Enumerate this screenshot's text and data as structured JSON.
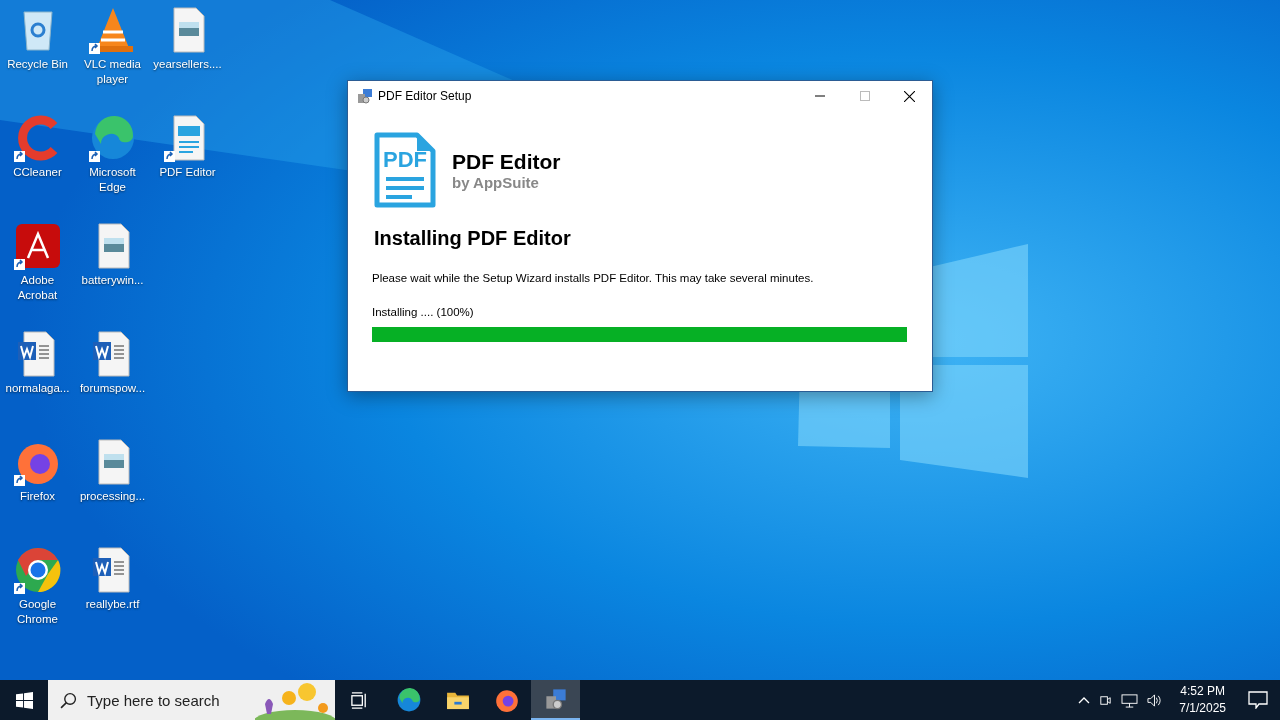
{
  "desktop": {
    "icons": [
      {
        "label": "Recycle Bin",
        "kind": "recycle",
        "shortcut": false
      },
      {
        "label": "CCleaner",
        "kind": "ccleaner",
        "shortcut": true
      },
      {
        "label": "Adobe Acrobat",
        "kind": "acrobat",
        "shortcut": true
      },
      {
        "label": "normalaga...",
        "kind": "word",
        "shortcut": false
      },
      {
        "label": "Firefox",
        "kind": "firefox",
        "shortcut": true
      },
      {
        "label": "Google Chrome",
        "kind": "chrome",
        "shortcut": true
      },
      {
        "label": "VLC media player",
        "kind": "vlc",
        "shortcut": true
      },
      {
        "label": "Microsoft Edge",
        "kind": "edge",
        "shortcut": true
      },
      {
        "label": "batterywin...",
        "kind": "image",
        "shortcut": false
      },
      {
        "label": "forumspow...",
        "kind": "word",
        "shortcut": false
      },
      {
        "label": "processing...",
        "kind": "image",
        "shortcut": false
      },
      {
        "label": "reallybe.rtf",
        "kind": "word",
        "shortcut": false
      },
      {
        "label": "yearsellers....",
        "kind": "image",
        "shortcut": false
      },
      {
        "label": "PDF Editor",
        "kind": "pdf",
        "shortcut": true
      }
    ]
  },
  "window": {
    "title": "PDF Editor Setup",
    "product": {
      "logo_text": "PDF",
      "name": "PDF Editor",
      "vendor": "by AppSuite"
    },
    "heading": "Installing PDF Editor",
    "message": "Please wait while the Setup Wizard installs PDF Editor. This may take several minutes.",
    "progress": {
      "label": "Installing .... (100%)",
      "level": 1.0
    }
  },
  "taskbar": {
    "search": {
      "placeholder": "Type here to search"
    },
    "apps": [
      {
        "kind": "taskview",
        "selected": false
      },
      {
        "kind": "edge",
        "selected": false
      },
      {
        "kind": "explorer",
        "selected": false
      },
      {
        "kind": "firefox",
        "selected": false
      },
      {
        "kind": "setup",
        "selected": true
      }
    ],
    "clock": {
      "time": "4:52 PM",
      "date": "7/1/2025"
    }
  }
}
